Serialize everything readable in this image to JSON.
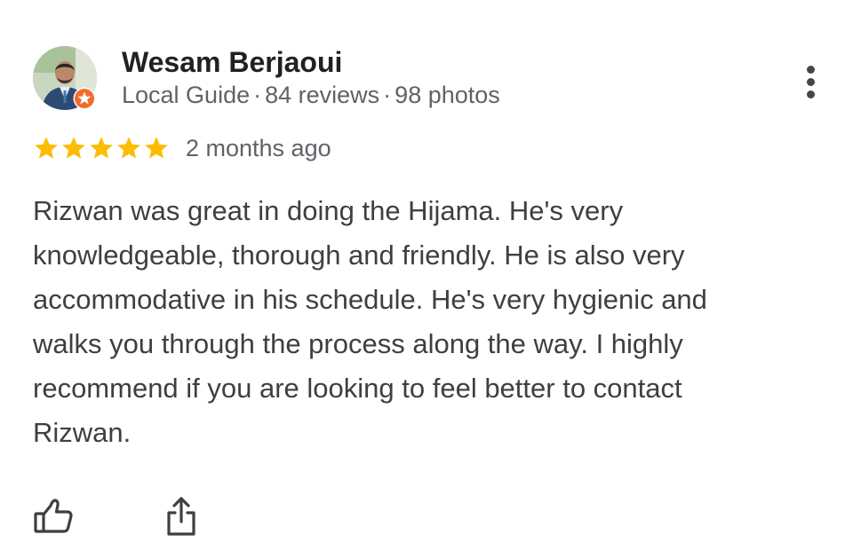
{
  "review": {
    "author": {
      "name": "Wesam Berjaoui",
      "badge": "Local Guide",
      "reviews": "84 reviews",
      "photos": "98 photos",
      "separator": "·"
    },
    "rating": {
      "stars": 5,
      "max": 5,
      "date": "2 months ago"
    },
    "text": "Rizwan was great in doing the Hijama. He's very\nknowledgeable, thorough and friendly. He is also very\naccommodative in his schedule. He's very hygienic and\nwalks you through the process along the way. I highly\nrecommend if you are looking to feel better to contact\nRizwan.",
    "actions": {
      "like_icon": "thumbs-up-icon",
      "share_icon": "share-icon",
      "more_icon": "more-vertical-icon"
    }
  },
  "colors": {
    "star": "#fbbc04",
    "badge": "#f26b2a",
    "name": "#202124",
    "meta": "#5f6368",
    "body": "#3c4043"
  }
}
